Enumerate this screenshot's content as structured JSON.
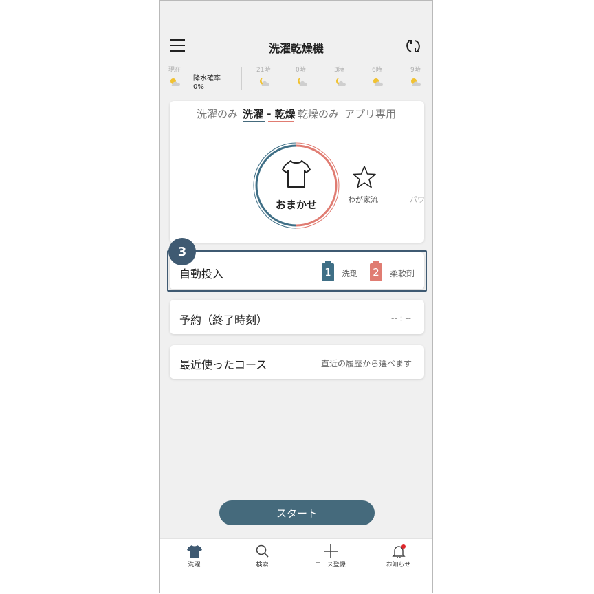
{
  "header": {
    "title": "洗濯乾燥機",
    "menu_icon": "hamburger-menu-icon",
    "refresh_icon": "refresh-icon"
  },
  "weather": {
    "current_label": "現在",
    "rain_label": "降水確率",
    "rain_value": "0%",
    "slots": [
      "21時",
      "0時",
      "3時",
      "6時",
      "9時"
    ],
    "icons": [
      "sun-cloud-icon",
      "moon-cloud-icon",
      "moon-cloud-icon",
      "moon-cloud-icon",
      "sun-cloud-icon",
      "sun-cloud-icon"
    ]
  },
  "mode_tabs": [
    {
      "label": "洗濯のみ",
      "active": false
    },
    {
      "label": "洗濯 - 乾燥",
      "active": true
    },
    {
      "label": "乾燥のみ",
      "active": false
    },
    {
      "label": "アプリ専用",
      "active": false
    }
  ],
  "courses": {
    "main": "おまかせ",
    "second": "わが家流",
    "third_partial": "パワ"
  },
  "step_badge": "3",
  "auto_dose": {
    "label": "自動投入",
    "tank1_num": "1",
    "tank1_label": "洗剤",
    "tank2_num": "2",
    "tank2_label": "柔軟剤",
    "tank1_color": "#3f6f86",
    "tank2_color": "#e07c72"
  },
  "reservation": {
    "label": "予約（終了時刻）",
    "value": "-- : --"
  },
  "recent": {
    "label": "最近使ったコース",
    "hint": "直近の履歴から選べます"
  },
  "start_label": "スタート",
  "nav": [
    {
      "label": "洗濯",
      "icon": "shirt-icon"
    },
    {
      "label": "検索",
      "icon": "search-icon"
    },
    {
      "label": "コース登録",
      "icon": "plus-icon"
    },
    {
      "label": "お知らせ",
      "icon": "bell-icon"
    }
  ],
  "colors": {
    "accent_blue": "#456a7c",
    "accent_red": "#e07c72",
    "notification_dot": "#e0262b"
  }
}
